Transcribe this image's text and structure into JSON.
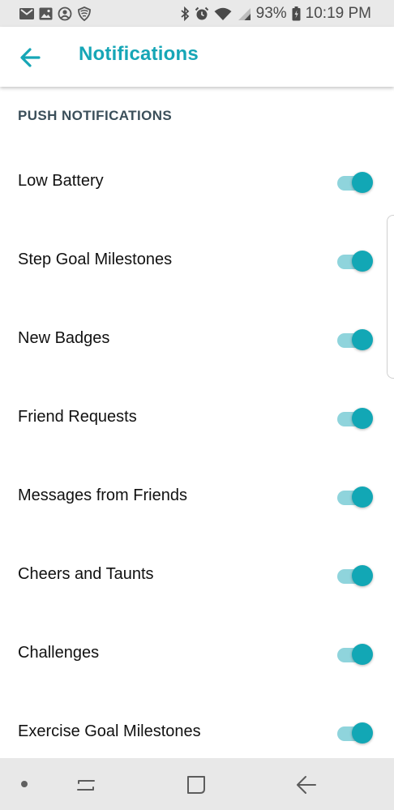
{
  "status_bar": {
    "battery": "93%",
    "time": "10:19 PM",
    "left_icons": [
      "gmail-icon",
      "gallery-icon",
      "account-icon",
      "shield-icon"
    ],
    "right_icons": [
      "bluetooth-icon",
      "alarm-icon",
      "wifi-icon",
      "signal-icon",
      "battery-icon"
    ]
  },
  "header": {
    "title": "Notifications",
    "back_icon": "arrow-left-icon"
  },
  "section": {
    "title": "PUSH NOTIFICATIONS"
  },
  "settings": [
    {
      "label": "Low Battery",
      "enabled": true
    },
    {
      "label": "Step Goal Milestones",
      "enabled": true
    },
    {
      "label": "New Badges",
      "enabled": true
    },
    {
      "label": "Friend Requests",
      "enabled": true
    },
    {
      "label": "Messages from Friends",
      "enabled": true
    },
    {
      "label": "Cheers and Taunts",
      "enabled": true
    },
    {
      "label": "Challenges",
      "enabled": true
    },
    {
      "label": "Exercise Goal Milestones",
      "enabled": true
    }
  ],
  "nav_bar": {
    "buttons": [
      "recent-apps-icon",
      "home-icon",
      "back-icon"
    ]
  },
  "colors": {
    "accent": "#16a6b6",
    "toggle_thumb": "#12a7b5",
    "toggle_track": "#8fd4dc",
    "section_header": "#3b4f5a"
  }
}
